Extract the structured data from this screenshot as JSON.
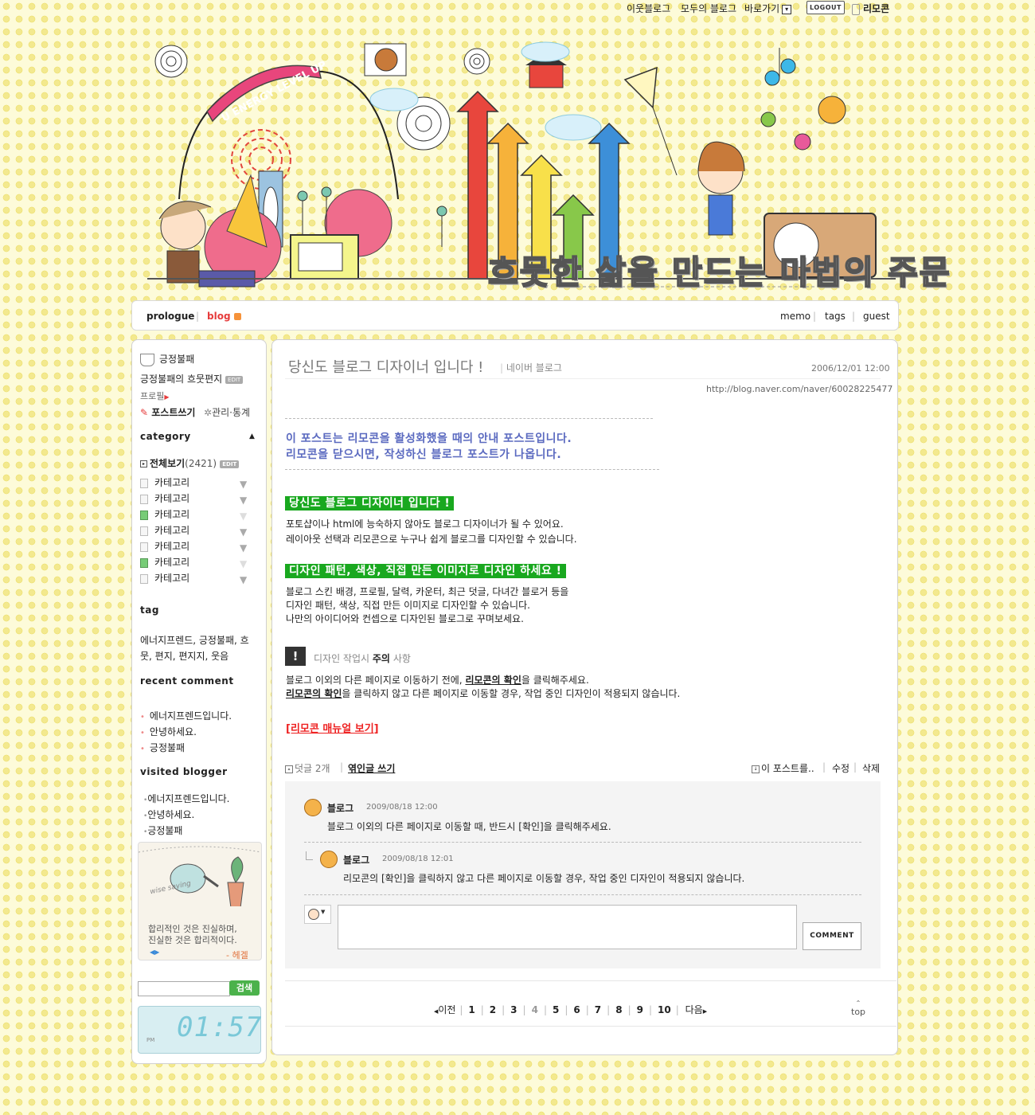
{
  "topbar": {
    "neighbor": "이웃블로그",
    "all_blogs": "모두의 블로그",
    "shortcut": "바로가기",
    "logout": "LOGOUT",
    "remocon": "리모콘"
  },
  "header": {
    "banner_title": "흐뭇한 삶을 만드는 마법의 주문",
    "ribbon": "U ENERGY LEVEL UP"
  },
  "nav": {
    "prologue": "prologue",
    "blog": "blog",
    "memo": "memo",
    "tags": "tags",
    "guest": "guest"
  },
  "sidebar": {
    "nickname": "긍정불패",
    "blog_title": "긍정불패의 흐뭇편지",
    "edit": "EDIT",
    "profile": "프로필",
    "write_post": "포스트쓰기",
    "manage": "관리·통계",
    "category_heading": "category",
    "all_view": "전체보기",
    "all_count": "(2421)",
    "categories": [
      {
        "label": "카테고리",
        "arrow": true
      },
      {
        "label": "카테고리",
        "arrow": true
      },
      {
        "label": "카테고리",
        "arrow": false
      },
      {
        "label": "카테고리",
        "arrow": true
      },
      {
        "label": "카테고리",
        "arrow": true
      },
      {
        "label": "카테고리",
        "arrow": false
      },
      {
        "label": "카테고리",
        "arrow": true
      }
    ],
    "tag_heading": "tag",
    "tag_line1": "에너지프렌드, 긍정불패, 흐",
    "tag_line2": "뭇, 편지, 편지지, 웃음",
    "recent_comment_heading": "recent comment",
    "recent_comments": [
      "에너지프렌드입니다.",
      "안녕하세요.",
      "긍정불패"
    ],
    "visited_heading": "visited blogger",
    "visited": [
      "에너지프렌드입니다.",
      "안녕하세요.",
      "긍정불패"
    ],
    "saying_line1": "합리적인 것은 진실하며,",
    "saying_line2": "진실한 것은 합리적이다.",
    "saying_author": "- 헤겔",
    "wise_saying": "wise saying",
    "search_button": "검색",
    "clock_time": "01:57",
    "clock_ampm": "PM"
  },
  "post": {
    "title": "당신도 블로그 디자이너 입니다 !",
    "category": "네이버 블로그",
    "date": "2006/12/01 12:00",
    "url": "http://blog.naver.com/naver/60028225477",
    "notice1": "이 포스트는 리모콘을 활성화했을 때의 안내 포스트입니다.",
    "notice2": "리모콘을 닫으시면, 작성하신 블로그 포스트가 나옵니다.",
    "heading1": "당신도 블로그 디자이너 입니다 !",
    "p1_line1": "포토샵이나 html에 능숙하지 않아도 블로그 디자이너가 될 수 있어요.",
    "p1_line2": "레이아웃 선택과 리모콘으로 누구나 쉽게 블로그를 디자인할 수 있습니다.",
    "heading2": "디자인 패턴, 색상, 직접 만든 이미지로 디자인 하세요 !",
    "p2_line1": "블로그 스킨 배경, 프로필, 달력, 카운터, 최근 덧글, 다녀간 블로거 등을",
    "p2_line2": "디자인 패턴, 색상, 직접 만든 이미지로 디자인할 수 있습니다.",
    "p2_line3": "나만의 아이디어와 컨셉으로 디자인된 블로그로 꾸며보세요.",
    "caution_pre": "디자인 작업시",
    "caution_bold": "주의",
    "caution_post": "사항",
    "c1_pre": "블로그 이외의 다른 페이지로 이동하기 전에,",
    "c1_link": "리모콘의 확인",
    "c1_post": "을 클릭해주세요.",
    "c2_link": "리모콘의 확인",
    "c2_post": "을 클릭하지 않고 다른 페이지로 이동할 경우, 작업 중인 디자인이 적용되지 않습니다.",
    "manual_link": "[리모콘 매뉴얼 보기]",
    "comment_count": "덧글 2개",
    "trackback": "엮인글 쓰기",
    "this_post": "이 포스트를..",
    "edit": "수정",
    "delete": "삭제"
  },
  "comments": [
    {
      "author": "블로그",
      "date": "2009/08/18 12:00",
      "text": "블로그 이외의 다른 페이지로 이동할 때, 반드시 [확인]을 클릭해주세요."
    },
    {
      "author": "블로그",
      "date": "2009/08/18 12:01",
      "text": "리모콘의 [확인]을 클릭하지 않고 다른 페이지로 이동할 경우, 작업 중인 디자인이 적용되지 않습니다."
    }
  ],
  "comment_form": {
    "submit": "COMMENT"
  },
  "pager": {
    "prev": "이전",
    "pages": [
      "1",
      "2",
      "3",
      "4",
      "5",
      "6",
      "7",
      "8",
      "9",
      "10"
    ],
    "current": "4",
    "next": "다음",
    "top": "top"
  }
}
